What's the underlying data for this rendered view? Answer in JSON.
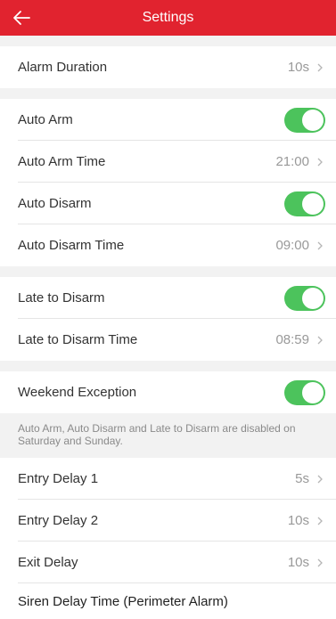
{
  "header": {
    "title": "Settings"
  },
  "sections": {
    "alarm_duration": {
      "label": "Alarm Duration",
      "value": "10s"
    },
    "auto_arm": {
      "label": "Auto Arm"
    },
    "auto_arm_time": {
      "label": "Auto Arm Time",
      "value": "21:00"
    },
    "auto_disarm": {
      "label": "Auto Disarm"
    },
    "auto_disarm_time": {
      "label": "Auto Disarm Time",
      "value": "09:00"
    },
    "late_to_disarm": {
      "label": "Late to Disarm"
    },
    "late_to_disarm_time": {
      "label": "Late to Disarm Time",
      "value": "08:59"
    },
    "weekend_exception": {
      "label": "Weekend Exception"
    },
    "weekend_note": "Auto Arm, Auto Disarm and Late to Disarm are disabled on Saturday and Sunday.",
    "entry_delay_1": {
      "label": "Entry Delay 1",
      "value": "5s"
    },
    "entry_delay_2": {
      "label": "Entry Delay 2",
      "value": "10s"
    },
    "exit_delay": {
      "label": "Exit Delay",
      "value": "10s"
    },
    "partial_row": {
      "label": "Siren Delay Time (Perimeter Alarm)"
    }
  },
  "toggles": {
    "auto_arm": true,
    "auto_disarm": true,
    "late_to_disarm": true,
    "weekend_exception": true
  },
  "colors": {
    "header": "#e1232f",
    "toggle_on": "#4cc35c"
  },
  "icons": {
    "back": "back-arrow-icon",
    "chevron": "chevron-right-icon"
  }
}
